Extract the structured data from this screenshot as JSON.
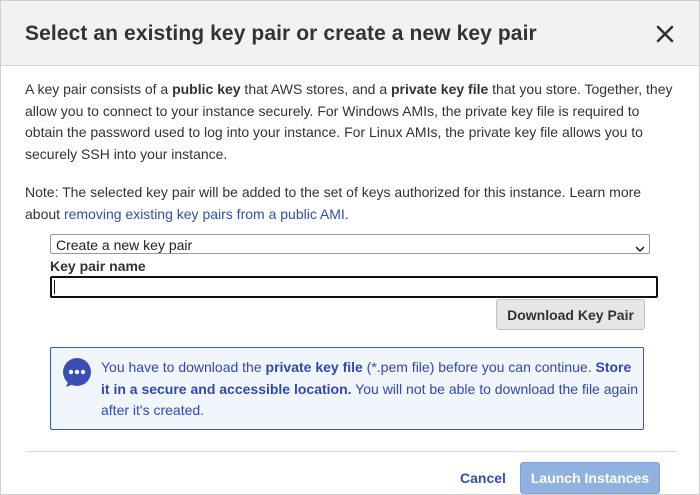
{
  "dialog": {
    "title": "Select an existing key pair or create a new key pair",
    "close_icon": "close-icon"
  },
  "intro": {
    "p1": "A key pair consists of a ",
    "b1": "public key",
    "p2": " that AWS stores, and a ",
    "b2": "private key file",
    "p3": " that you store. Together, they allow you to connect to your instance securely. For Windows AMIs, the private key file is required to obtain the password used to log into your instance. For Linux AMIs, the private key file allows you to securely SSH into your instance."
  },
  "note": {
    "text": "Note: The selected key pair will be added to the set of keys authorized for this instance. Learn more about ",
    "link": "removing existing key pairs from a public AMI",
    "end": "."
  },
  "key_select": {
    "selected": "Create a new key pair",
    "chevron_icon": "chevron-down-icon"
  },
  "key_name": {
    "label": "Key pair name",
    "value": "",
    "placeholder": ""
  },
  "download_button": "Download Key Pair",
  "info": {
    "icon": "chat-bubble-icon",
    "t1": "You have to download the ",
    "b1": "private key file",
    "t2": " (*.pem file) before you can continue. ",
    "b2": "Store it in a secure and accessible location.",
    "t3": " You will not be able to download the file again after it's created."
  },
  "footer": {
    "cancel": "Cancel",
    "launch": "Launch Instances"
  },
  "colors": {
    "link": "#2f4fb0",
    "info_text": "#2f49b4",
    "info_bg": "#f1f5fc",
    "launch_bg": "#8fb2e0"
  }
}
